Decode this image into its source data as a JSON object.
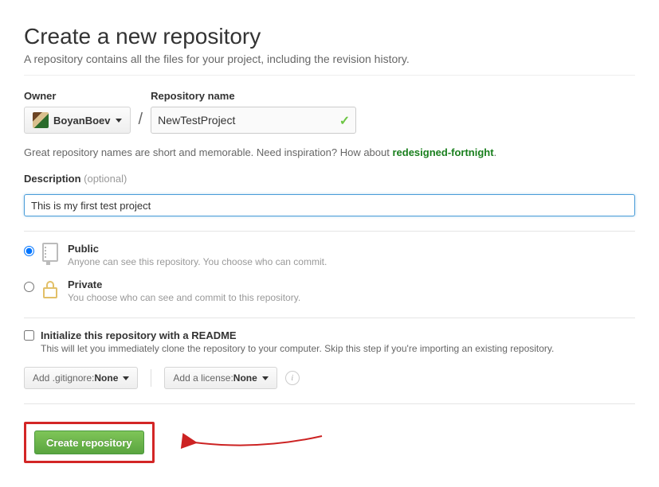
{
  "header": {
    "title": "Create a new repository",
    "subtitle": "A repository contains all the files for your project, including the revision history."
  },
  "owner": {
    "label": "Owner",
    "name": "BoyanBoev"
  },
  "repo": {
    "label": "Repository name",
    "value": "NewTestProject"
  },
  "hint": {
    "text": "Great repository names are short and memorable. Need inspiration? How about ",
    "suggestion": "redesigned-fortnight"
  },
  "description": {
    "label": "Description",
    "optional": "(optional)",
    "value": "This is my first test project"
  },
  "visibility": {
    "public": {
      "title": "Public",
      "sub": "Anyone can see this repository. You choose who can commit."
    },
    "private": {
      "title": "Private",
      "sub": "You choose who can see and commit to this repository."
    }
  },
  "init": {
    "title": "Initialize this repository with a README",
    "sub": "This will let you immediately clone the repository to your computer. Skip this step if you're importing an existing repository."
  },
  "gitignore": {
    "prefix": "Add .gitignore: ",
    "value": "None"
  },
  "license": {
    "prefix": "Add a license: ",
    "value": "None"
  },
  "create_label": "Create repository"
}
